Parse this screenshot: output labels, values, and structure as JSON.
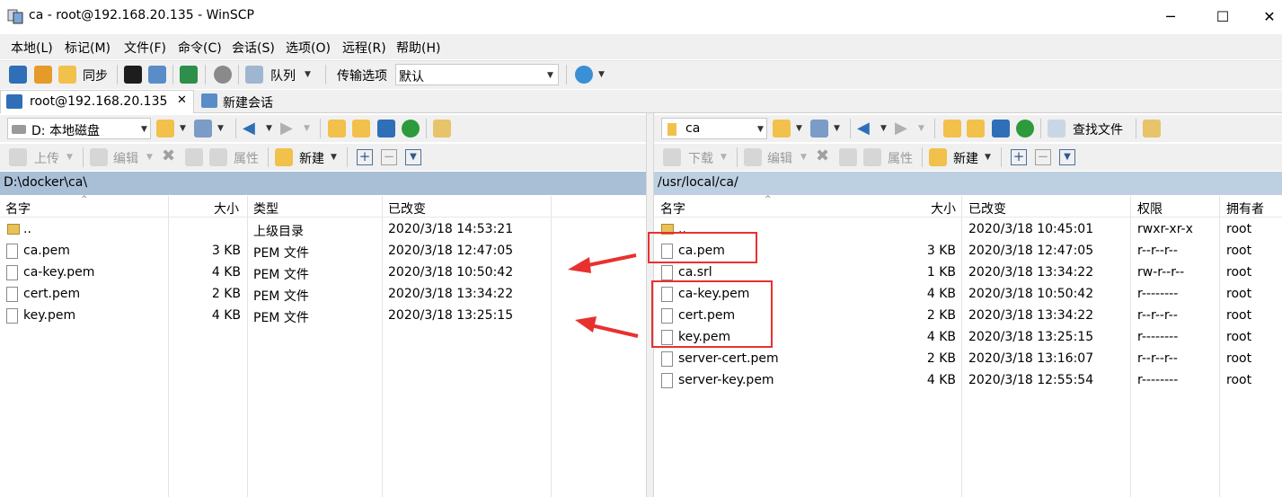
{
  "window": {
    "title": "ca - root@192.168.20.135 - WinSCP",
    "minimize": "─",
    "maximize": "☐",
    "close": "✕"
  },
  "menu": [
    "本地(L)",
    "标记(M)",
    "文件(F)",
    "命令(C)",
    "会话(S)",
    "选项(O)",
    "远程(R)",
    "帮助(H)"
  ],
  "toolbar": {
    "sync_label": "同步",
    "queue_label": "队列",
    "transfer_label": "传输选项",
    "transfer_value": "默认"
  },
  "tabs": {
    "session": "root@192.168.20.135",
    "session_close": "✕",
    "new_session": "新建会话"
  },
  "left": {
    "drive": "D: 本地磁盘",
    "upload": "上传",
    "edit": "编辑",
    "properties": "属性",
    "new": "新建",
    "path": "D:\\docker\\ca\\",
    "columns": [
      "名字",
      "大小",
      "类型",
      "已改变"
    ],
    "files": [
      {
        "name": "..",
        "size": "",
        "type": "上级目录",
        "changed": "2020/3/18  14:53:21"
      },
      {
        "name": "ca.pem",
        "size": "3 KB",
        "type": "PEM 文件",
        "changed": "2020/3/18  12:47:05"
      },
      {
        "name": "ca-key.pem",
        "size": "4 KB",
        "type": "PEM 文件",
        "changed": "2020/3/18  10:50:42"
      },
      {
        "name": "cert.pem",
        "size": "2 KB",
        "type": "PEM 文件",
        "changed": "2020/3/18  13:34:22"
      },
      {
        "name": "key.pem",
        "size": "4 KB",
        "type": "PEM 文件",
        "changed": "2020/3/18  13:25:15"
      }
    ]
  },
  "right": {
    "folder": "ca",
    "download": "下载",
    "edit": "编辑",
    "properties": "属性",
    "new": "新建",
    "find": "查找文件",
    "path": "/usr/local/ca/",
    "columns": [
      "名字",
      "大小",
      "已改变",
      "权限",
      "拥有者"
    ],
    "files": [
      {
        "name": "..",
        "size": "",
        "changed": "2020/3/18 10:45:01",
        "perm": "rwxr-xr-x",
        "owner": "root"
      },
      {
        "name": "ca.pem",
        "size": "3 KB",
        "changed": "2020/3/18 12:47:05",
        "perm": "r--r--r--",
        "owner": "root"
      },
      {
        "name": "ca.srl",
        "size": "1 KB",
        "changed": "2020/3/18 13:34:22",
        "perm": "rw-r--r--",
        "owner": "root"
      },
      {
        "name": "ca-key.pem",
        "size": "4 KB",
        "changed": "2020/3/18 10:50:42",
        "perm": "r--------",
        "owner": "root"
      },
      {
        "name": "cert.pem",
        "size": "2 KB",
        "changed": "2020/3/18 13:34:22",
        "perm": "r--r--r--",
        "owner": "root"
      },
      {
        "name": "key.pem",
        "size": "4 KB",
        "changed": "2020/3/18 13:25:15",
        "perm": "r--------",
        "owner": "root"
      },
      {
        "name": "server-cert.pem",
        "size": "2 KB",
        "changed": "2020/3/18 13:16:07",
        "perm": "r--r--r--",
        "owner": "root"
      },
      {
        "name": "server-key.pem",
        "size": "4 KB",
        "changed": "2020/3/18 12:55:54",
        "perm": "r--------",
        "owner": "root"
      }
    ]
  },
  "colors": {
    "path_left": "#a9bfd6",
    "path_right": "#bdd0e2",
    "annotation": "#e8312f"
  }
}
